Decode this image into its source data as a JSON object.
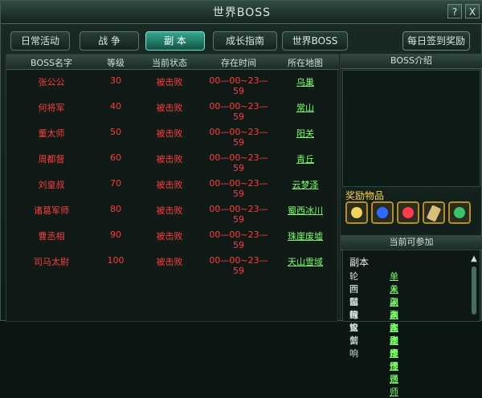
{
  "window": {
    "title": "世界BOSS",
    "help_label": "?",
    "close_label": "X"
  },
  "tabs": [
    {
      "label": "日常活动",
      "active": false
    },
    {
      "label": "战 争",
      "active": false
    },
    {
      "label": "副 本",
      "active": true
    },
    {
      "label": "成长指南",
      "active": false
    },
    {
      "label": "世界BOSS",
      "active": false
    }
  ],
  "daily_button": "每日签到奖励",
  "table": {
    "headers": [
      "BOSS名字",
      "等级",
      "当前状态",
      "存在时间",
      "所在地图"
    ],
    "rows": [
      {
        "name": "张公公",
        "level": "30",
        "status": "被击败",
        "time": "00—00~23—59",
        "map": "乌巢"
      },
      {
        "name": "何将军",
        "level": "40",
        "status": "被击败",
        "time": "00—00~23—59",
        "map": "常山"
      },
      {
        "name": "董太师",
        "level": "50",
        "status": "被击败",
        "time": "00—00~23—59",
        "map": "阳关"
      },
      {
        "name": "周都督",
        "level": "60",
        "status": "被击败",
        "time": "00—00~23—59",
        "map": "青丘"
      },
      {
        "name": "刘皇叔",
        "level": "70",
        "status": "被击败",
        "time": "00—00~23—59",
        "map": "云梦泽"
      },
      {
        "name": "诸葛军师",
        "level": "80",
        "status": "被击败",
        "time": "00—00~23—59",
        "map": "蜀西冰川"
      },
      {
        "name": "曹丞相",
        "level": "90",
        "status": "被击败",
        "time": "00—00~23—59",
        "map": "珠崖废墟"
      },
      {
        "name": "司马太尉",
        "level": "100",
        "status": "被击败",
        "time": "00—00~23—59",
        "map": "天山雪域"
      }
    ]
  },
  "right": {
    "intro_title": "BOSS介绍",
    "reward_title": "奖励物品",
    "rewards": [
      {
        "icon": "gold-gem-icon",
        "color": "#f2d35b"
      },
      {
        "icon": "blue-gem-icon",
        "color": "#2c6bff"
      },
      {
        "icon": "red-gem-icon",
        "color": "#ff3b4a"
      },
      {
        "icon": "scroll-icon",
        "color": "#d9c07a"
      },
      {
        "icon": "green-item-icon",
        "color": "#39c46a"
      }
    ],
    "available_title": "当前可参加",
    "available_section": "副本",
    "available": [
      {
        "name": "轮回试炼",
        "link": "单人副本传送师"
      },
      {
        "name": "西园行宫",
        "link": "单人副本传送师"
      },
      {
        "name": "鬈瞳论剑",
        "link": "单人副本传送师"
      },
      {
        "name": "匈奴营响",
        "link": "单人副本传送师"
      }
    ]
  }
}
